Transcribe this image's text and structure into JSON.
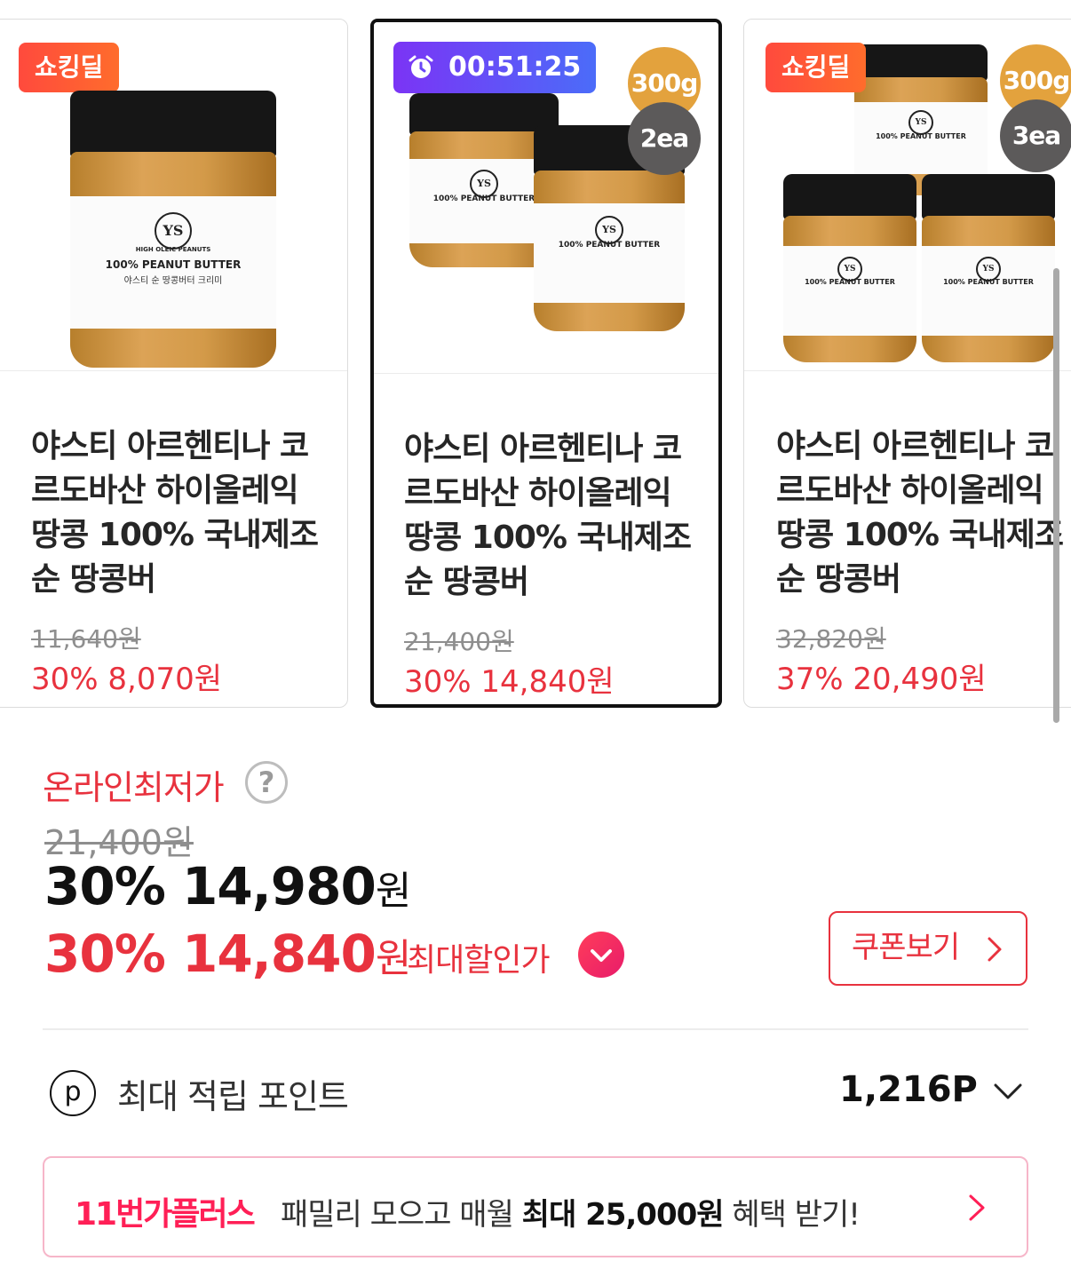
{
  "products": [
    {
      "badge": "쇼킹딜",
      "title": "야스티 아르헨티나 코르도바산 하이올레익 땅콩 100% 국내제조 순 땅콩버",
      "original_price": "11,640원",
      "sale_price": "30% 8,070원",
      "jar_label": {
        "brand": "HIGH OLEIC PEANUTS",
        "name": "100% PEANUT BUTTER",
        "sub": "야스티 순 땅콩버터 크리미"
      }
    },
    {
      "timer": "00:51:25",
      "weight": "300g",
      "count": "2ea",
      "title": "야스티 아르헨티나 코르도바산 하이올레익 땅콩 100% 국내제조 순 땅콩버",
      "original_price": "21,400원",
      "sale_price": "30% 14,840원",
      "selected": true
    },
    {
      "badge": "쇼킹딜",
      "weight": "300g",
      "count": "3ea",
      "title": "야스티 아르헨티나 코르도바산 하이올레익 땅콩 100% 국내제조 순 땅콩버",
      "original_price": "32,820원",
      "sale_price": "37% 20,490원"
    }
  ],
  "price_section": {
    "lowest_label": "온라인최저가",
    "help": "?",
    "original_price": "21,400원",
    "price_rate": "30%",
    "price_amount": "14,980",
    "max_rate": "30%",
    "max_amount": "14,840",
    "won": "원",
    "max_discount_label": "최대할인가",
    "coupon_button": "쿠폰보기"
  },
  "points": {
    "icon_letter": "p",
    "label": "최대 적립 포인트",
    "value": "1,216P"
  },
  "banner": {
    "brand": "11번가플러스",
    "msg_pre": "패밀리 모으고 매월 ",
    "msg_bold": "최대 25,000원",
    "msg_post": " 혜택 받기!"
  },
  "colors": {
    "accent_red": "#e8323e",
    "deal_orange": "#ff4a3d",
    "timer_purple": "#7b34f5",
    "weight_gold": "#e3a23d",
    "count_gray": "#5c5a5a",
    "plus_pink": "#ff1f56"
  }
}
